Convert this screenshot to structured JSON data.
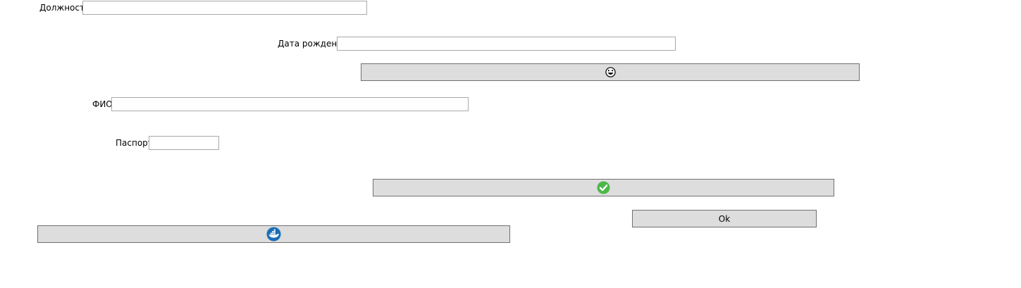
{
  "form": {
    "position_label": "Должность",
    "position_value": "",
    "birthdate_label": "Дата рождения",
    "birthdate_value": "",
    "fullname_label": "ФИО",
    "fullname_value": "",
    "passport_label": "Паспорт",
    "passport_value": ""
  },
  "buttons": {
    "emoji_icon": "laughing-face-icon",
    "confirm_icon": "green-checkmark-icon",
    "ok_label": "Ok",
    "docker_icon": "docker-whale-icon"
  },
  "colors": {
    "button_background": "#dddddd",
    "button_border": "#707070",
    "field_border": "#a9a9a9",
    "check_green": "#4db848",
    "docker_blue": "#1a6fb8"
  }
}
